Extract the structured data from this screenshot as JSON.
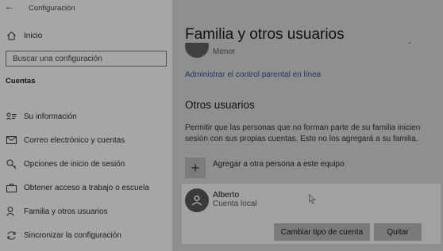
{
  "window": {
    "title": "Configuración"
  },
  "sidebar": {
    "home_label": "Inicio",
    "search_placeholder": "Buscar una configuración",
    "section_title": "Cuentas",
    "items": [
      {
        "label": "Su información",
        "icon": "person-card-icon"
      },
      {
        "label": "Correo electrónico y cuentas",
        "icon": "mail-icon"
      },
      {
        "label": "Opciones de inicio de sesión",
        "icon": "key-icon"
      },
      {
        "label": "Obtener acceso a trabajo o escuela",
        "icon": "briefcase-icon"
      },
      {
        "label": "Familia y otros usuarios",
        "icon": "people-icon"
      },
      {
        "label": "Sincronizar la configuración",
        "icon": "sync-icon"
      }
    ]
  },
  "main": {
    "title": "Familia y otros usuarios",
    "family_member_role": "Menor",
    "parental_link": "Administrar el control parental en línea",
    "other_users_title": "Otros usuarios",
    "other_users_description": "Permitir que las personas que no forman parte de su familia inicien sesión con sus propias cuentas. Esto no los agregará a su familia.",
    "add_user_label": "Agregar a otra persona a este equipo",
    "user": {
      "name": "Alberto",
      "account_type": "Cuenta local"
    },
    "change_account_type_label": "Cambiar tipo de cuenta",
    "remove_label": "Quitar"
  },
  "colors": {
    "link": "#1c3b66",
    "overlay_dim": "#8f8f8f"
  }
}
